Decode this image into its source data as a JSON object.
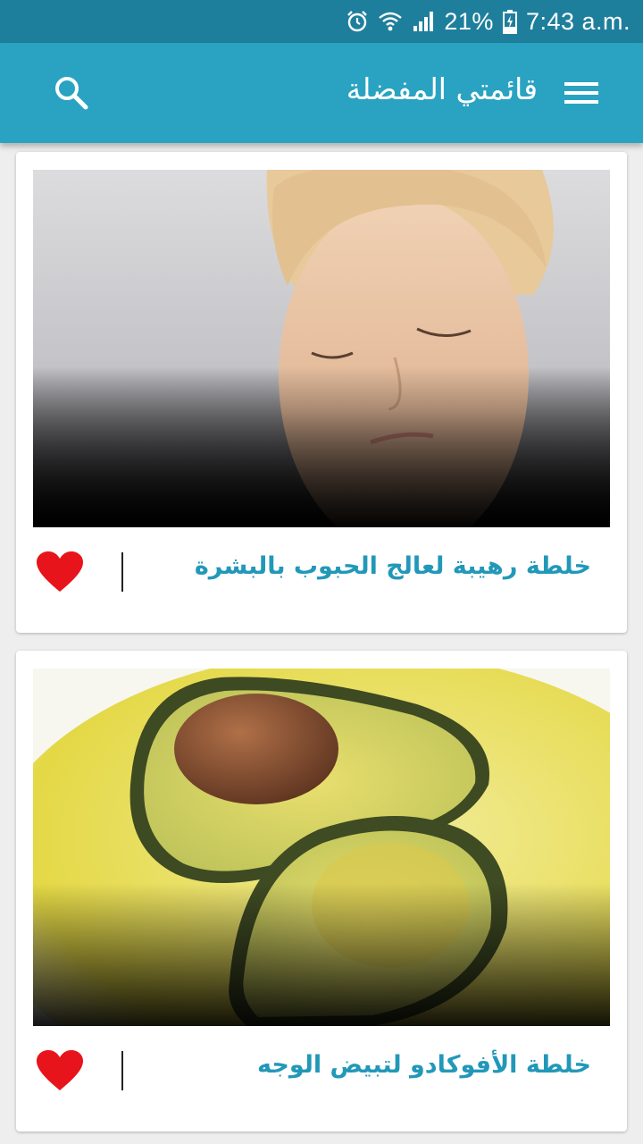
{
  "status_bar": {
    "battery": "21%",
    "time": "7:43 a.m."
  },
  "app_bar": {
    "title": "قائمتي المفضلة"
  },
  "items": [
    {
      "title": "خلطة رهيبة لعالج الحبوب بالبشرة",
      "favorited": true
    },
    {
      "title": "خلطة الأفوكادو لتبيض الوجه",
      "favorited": true
    }
  ],
  "colors": {
    "status_bar": "#1e7f9c",
    "app_bar": "#2aa3c2",
    "title_text": "#2298b8",
    "heart": "#e8141b"
  }
}
